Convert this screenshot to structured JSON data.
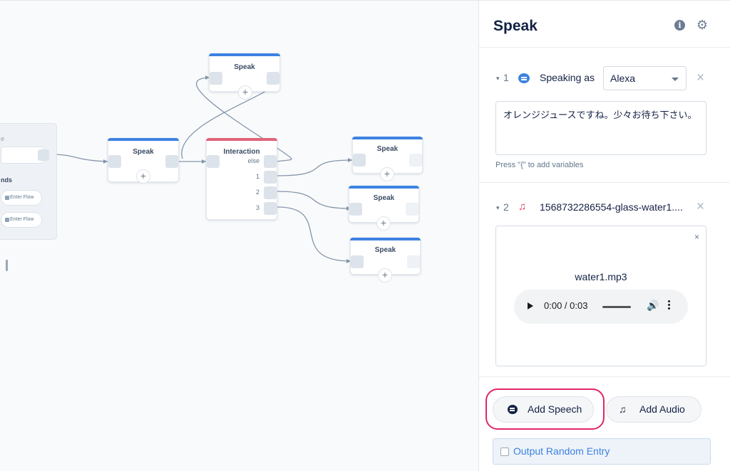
{
  "canvas": {
    "flow_block": {
      "header": "e",
      "section_label": "nds",
      "buttons": [
        "Enter Flow",
        "Enter Flow"
      ]
    },
    "nodes": {
      "speak_left": {
        "title": "Speak"
      },
      "speak_top": {
        "title": "Speak"
      },
      "interaction": {
        "title": "Interaction",
        "ports": [
          "else",
          "1",
          "2",
          "3"
        ]
      },
      "speak_r1": {
        "title": "Speak"
      },
      "speak_r2": {
        "title": "Speak"
      },
      "speak_r3": {
        "title": "Speak"
      }
    },
    "plus_symbol": "+"
  },
  "panel": {
    "title": "Speak",
    "items": [
      {
        "caret": "▾",
        "number": "1",
        "label": "Speaking as",
        "voice": "Alexa",
        "text": "オレンジジュースですね。少々お待ち下さい。",
        "hint": "Press \"{\" to add variables"
      },
      {
        "caret": "▾",
        "number": "2",
        "filename": "1568732286554-glass-water1....",
        "audio_name": "water1.mp3",
        "time": "0:00 / 0:03"
      }
    ],
    "add_speech_label": "Add Speech",
    "add_audio_label": "Add Audio",
    "random_entry_label": "Output Random Entry"
  },
  "colors": {
    "accent_blue": "#3d82e2",
    "interaction_red": "#e0637a",
    "highlight_pink": "#e0266a"
  }
}
